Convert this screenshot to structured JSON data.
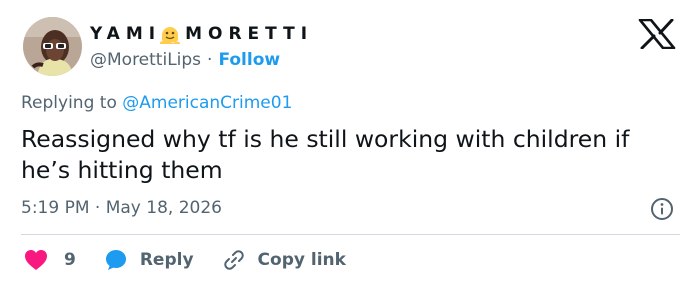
{
  "author": {
    "display_name_left": "YAMI",
    "display_name_right": "MORETTI",
    "handle": "@MorettiLips",
    "separator": "·",
    "follow_label": "Follow"
  },
  "reply_context": {
    "prefix": "Replying to",
    "mention": "@AmericanCrime01"
  },
  "tweet": {
    "text": "Reassigned why tf is he still working with children if he’s hitting them",
    "time": "5:19 PM",
    "separator": "·",
    "date": "May 18, 2026"
  },
  "actions": {
    "like_count": "9",
    "reply_label": "Reply",
    "copy_link_label": "Copy link"
  },
  "colors": {
    "text_primary": "#0f1419",
    "text_secondary": "#536471",
    "link": "#1d9bf0",
    "like": "#f91880",
    "divider": "#cfd9de"
  },
  "icons": [
    "x-logo-icon",
    "info-icon",
    "heart-icon",
    "reply-bubble-icon",
    "link-icon",
    "melting-face-emoji-icon"
  ]
}
